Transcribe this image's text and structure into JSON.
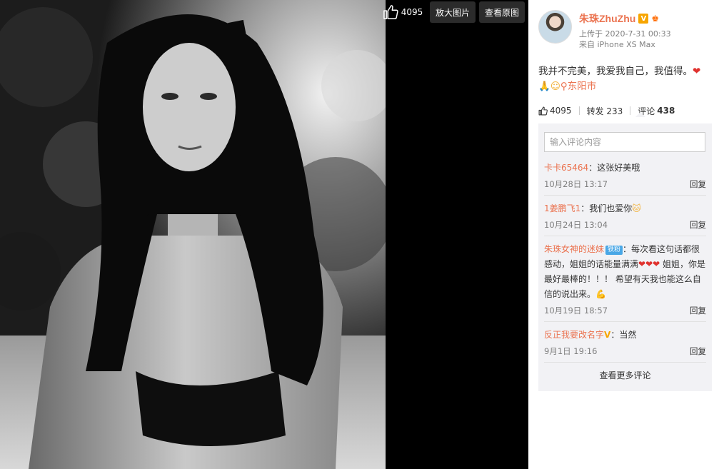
{
  "toolbar": {
    "like_count": "4095",
    "zoom_label": "放大图片",
    "original_label": "查看原图"
  },
  "author": {
    "name": "朱珠ZhuZhu",
    "verified_badge": "V",
    "uploaded": "上传于 2020-7-31 00:33",
    "device": "来自 iPhone XS Max"
  },
  "post": {
    "text": "我并不完美，我爱我自己，我值得。",
    "location": "东阳市"
  },
  "actions": {
    "likes": "4095",
    "repost": "转发 233",
    "comment_label": "评论",
    "comment_count": "438"
  },
  "comment_box": {
    "placeholder": "输入评论内容"
  },
  "comments": [
    {
      "user": "卡卡65464",
      "text": "：这张好美哦",
      "time": "10月28日 13:17",
      "reply": "回复"
    },
    {
      "user": "1姜鹏飞1",
      "text": "：我们也爱你",
      "time": "10月24日 13:04",
      "reply": "回复"
    },
    {
      "user": "朱珠女神的迷妹",
      "badge": "铁粉",
      "text": "：每次看这句话都很感动，姐姐的话能量满满",
      "text2": " 姐姐，你是最好最棒的！！！ 希望有天我也能这么自信的说出来。",
      "time": "10月19日 18:57",
      "reply": "回复"
    },
    {
      "user": "反正我要改名字",
      "text": "：当然",
      "time": "9月1日 19:16",
      "reply": "回复"
    }
  ],
  "more_comments": "查看更多评论",
  "colors": {
    "accent": "#eb7350",
    "comment_bg": "#f2f2f5",
    "viewer_bg": "#000000",
    "heart": "#e0322e"
  },
  "icons": {
    "like": "thumbs-up-icon",
    "location": "location-pin-icon",
    "heart": "heart-icon"
  }
}
